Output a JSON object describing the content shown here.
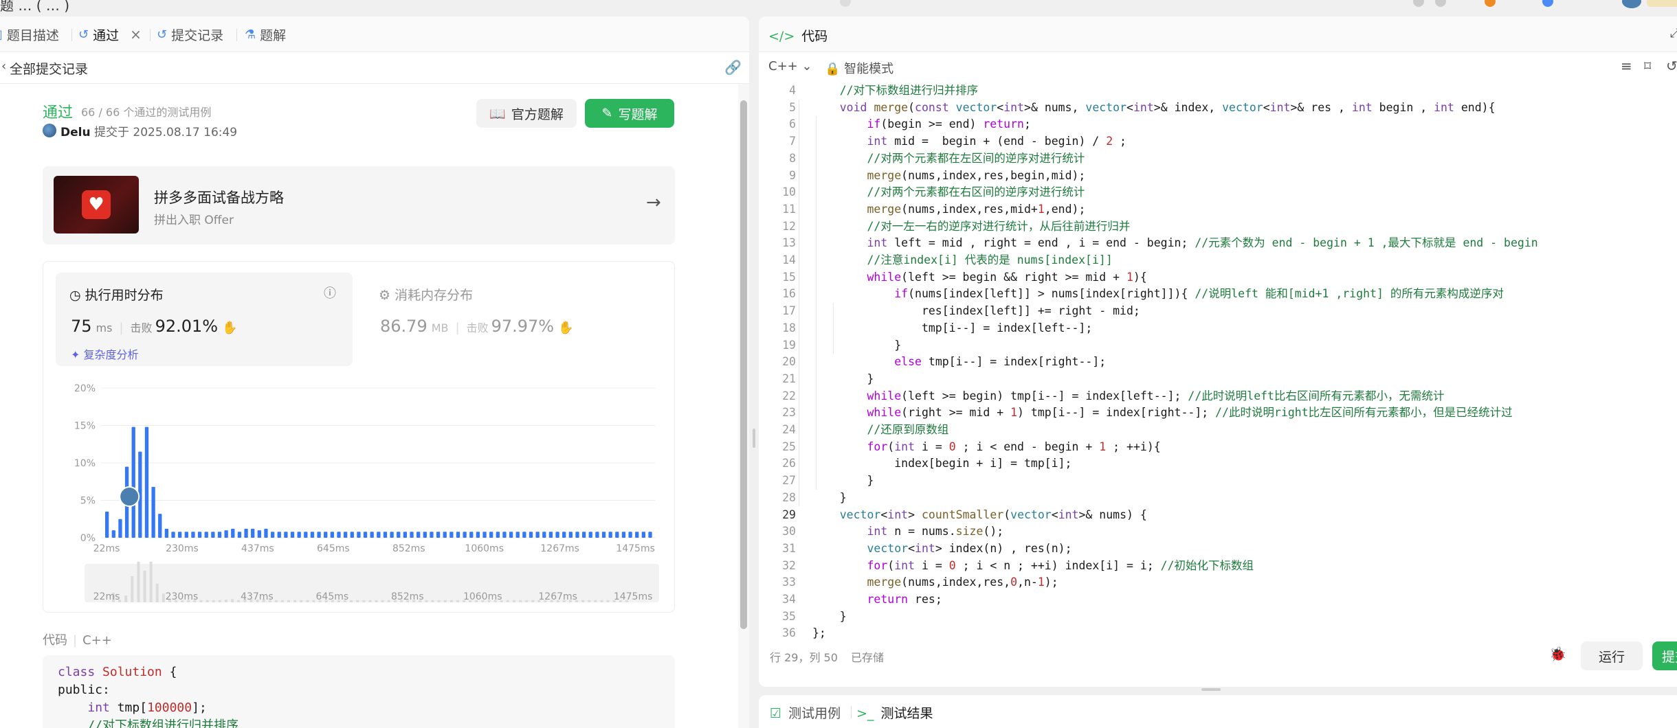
{
  "top": {
    "crumb": "题 … ( … )"
  },
  "left_tabs": [
    {
      "label": "题目描述",
      "icon": "document-icon"
    },
    {
      "label": "通过",
      "icon": "history-icon",
      "close": "×"
    },
    {
      "label": "提交记录",
      "icon": "history-icon"
    },
    {
      "label": "题解",
      "icon": "flask-icon"
    }
  ],
  "subheader": {
    "label": "全部提交记录"
  },
  "submission": {
    "status": "通过",
    "testcases": "66 / 66 个通过的测试用例",
    "user": "Delu",
    "submitted_at": "提交于 2025.08.17 16:49",
    "official_button": "官方题解",
    "write_button": "写题解"
  },
  "promo": {
    "title": "拼多多面试备战方略",
    "subtitle": "拼出入职 Offer"
  },
  "runtime": {
    "title": "执行用时分布",
    "value": "75",
    "unit": "ms",
    "beat_label": "击败",
    "beat_pct": "92.01%",
    "complexity_link": "复杂度分析"
  },
  "memory": {
    "title": "消耗内存分布",
    "value": "86.79",
    "unit": "MB",
    "beat_label": "击败",
    "beat_pct": "97.97%"
  },
  "chart_data": {
    "type": "bar",
    "ylim": [
      0,
      20
    ],
    "yticks": [
      "0%",
      "5%",
      "10%",
      "15%",
      "20%"
    ],
    "x_tick_labels": [
      "22ms",
      "230ms",
      "437ms",
      "645ms",
      "852ms",
      "1060ms",
      "1267ms",
      "1475ms"
    ],
    "values": [
      3.5,
      1,
      2.5,
      9.5,
      14.8,
      11.5,
      14.8,
      6.8,
      3.2,
      1.2,
      0.8,
      0.8,
      0.8,
      0.8,
      0.8,
      0.8,
      0.8,
      0.8,
      1,
      1.2,
      0.8,
      1.2,
      1.2,
      1,
      1.2,
      0.8,
      0.8,
      0.8,
      0.8,
      0.8,
      0.8,
      0.8,
      0.8,
      0.8,
      0.8,
      0.8,
      0.8,
      0.8,
      0.8,
      0.8,
      0.8,
      0.8,
      0.8,
      0.8,
      0.8,
      0.8,
      0.8,
      0.8,
      0.8,
      0.8,
      0.8,
      0.8,
      0.8,
      0.8,
      0.8,
      0.8,
      0.8,
      0.8,
      0.8,
      0.8,
      0.8,
      0.8,
      0.8,
      0.8,
      0.8,
      0.8,
      0.8,
      0.8,
      0.8,
      0.8,
      0.8,
      0.8,
      0.8,
      0.8,
      0.8,
      0.8,
      0.8,
      0.8,
      0.8,
      0.8,
      0.8,
      0.8,
      0.8
    ],
    "highlight_index": 4,
    "highlight_value": 5.5,
    "bar_color": "#3478f6"
  },
  "code_section": {
    "label": "代码",
    "lang": "C++",
    "preview": [
      "class Solution {",
      "public:",
      "    int tmp[100000];",
      "    //对下标数组进行归并排序"
    ]
  },
  "right": {
    "tab_label": "代码",
    "language": "C++",
    "mode": "智能模式",
    "code_lines": [
      {
        "n": "4",
        "text": "    //对下标数组进行归并排序"
      },
      {
        "n": "5",
        "text": "    void merge(const vector<int>& nums, vector<int>& index, vector<int>& res , int begin , int end){"
      },
      {
        "n": "6",
        "text": "        if(begin >= end) return;"
      },
      {
        "n": "7",
        "text": "        int mid =  begin + (end - begin) / 2 ;"
      },
      {
        "n": "8",
        "text": "        //对两个元素都在左区间的逆序对进行统计"
      },
      {
        "n": "9",
        "text": "        merge(nums,index,res,begin,mid);"
      },
      {
        "n": "10",
        "text": "        //对两个元素都在右区间的逆序对进行统计"
      },
      {
        "n": "11",
        "text": "        merge(nums,index,res,mid+1,end);"
      },
      {
        "n": "12",
        "text": "        //对一左一右的逆序对进行统计，从后往前进行归并"
      },
      {
        "n": "13",
        "text": "        int left = mid , right = end , i = end - begin; //元素个数为 end - begin + 1 ,最大下标就是 end - begin"
      },
      {
        "n": "14",
        "text": "        //注意index[i] 代表的是 nums[index[i]]"
      },
      {
        "n": "15",
        "text": "        while(left >= begin && right >= mid + 1){"
      },
      {
        "n": "16",
        "text": "            if(nums[index[left]] > nums[index[right]]){ //说明left 能和[mid+1 ,right] 的所有元素构成逆序对"
      },
      {
        "n": "17",
        "text": "                res[index[left]] += right - mid;"
      },
      {
        "n": "18",
        "text": "                tmp[i--] = index[left--];"
      },
      {
        "n": "19",
        "text": "            }"
      },
      {
        "n": "20",
        "text": "            else tmp[i--] = index[right--];"
      },
      {
        "n": "21",
        "text": "        }"
      },
      {
        "n": "22",
        "text": "        while(left >= begin) tmp[i--] = index[left--]; //此时说明left比右区间所有元素都小，无需统计"
      },
      {
        "n": "23",
        "text": "        while(right >= mid + 1) tmp[i--] = index[right--]; //此时说明right比左区间所有元素都小，但是已经统计过"
      },
      {
        "n": "24",
        "text": "        //还原到原数组"
      },
      {
        "n": "25",
        "text": "        for(int i = 0 ; i < end - begin + 1 ; ++i){"
      },
      {
        "n": "26",
        "text": "            index[begin + i] = tmp[i];"
      },
      {
        "n": "27",
        "text": "        }"
      },
      {
        "n": "28",
        "text": "    }"
      },
      {
        "n": "29",
        "text": "    vector<int> countSmaller(vector<int>& nums) {"
      },
      {
        "n": "30",
        "text": "        int n = nums.size();"
      },
      {
        "n": "31",
        "text": "        vector<int> index(n) , res(n);"
      },
      {
        "n": "32",
        "text": "        for(int i = 0 ; i < n ; ++i) index[i] = i; //初始化下标数组"
      },
      {
        "n": "33",
        "text": "        merge(nums,index,res,0,n-1);"
      },
      {
        "n": "34",
        "text": "        return res;"
      },
      {
        "n": "35",
        "text": "    }"
      },
      {
        "n": "36",
        "text": "};"
      }
    ],
    "current_line": "29",
    "cursor_pos": "行 29，列 50",
    "saved": "已存储",
    "run_button": "运行",
    "submit_button": "提交"
  },
  "bottom_tabs": {
    "testcase": "测试用例",
    "result": "测试结果"
  },
  "colors": {
    "accent_green": "#2db55d",
    "bar_blue": "#3478f6",
    "link_purple": "#5b62e8"
  }
}
